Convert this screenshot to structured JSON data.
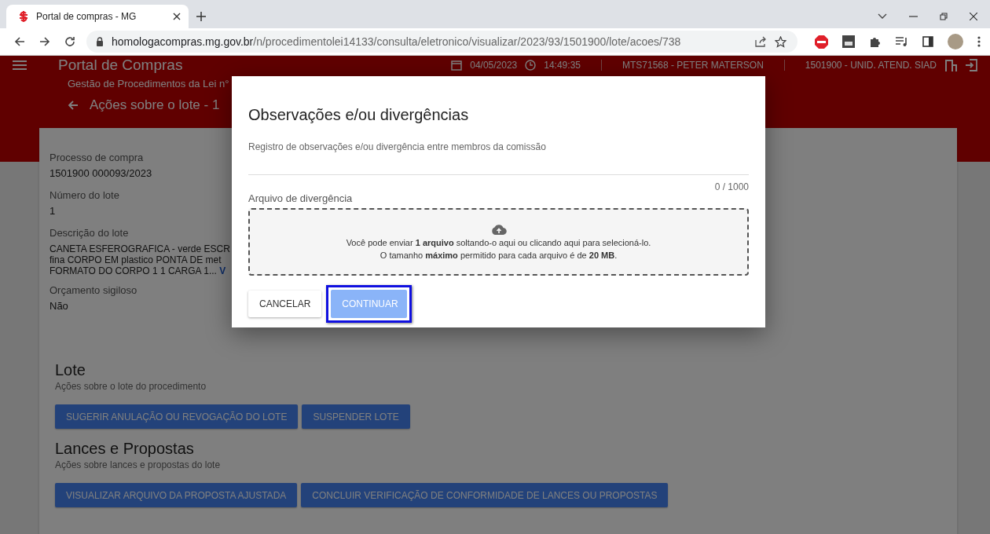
{
  "browser": {
    "tab_title": "Portal de compras - MG",
    "url_host": "homologacompras.mg.gov.br",
    "url_path": "/n/procedimentolei14133/consulta/eletronico/visualizar/2023/93/1501900/lote/acoes/738"
  },
  "header": {
    "title": "Portal de Compras",
    "date": "04/05/2023",
    "time": "14:49:35",
    "user": "MTS71568 - PETER MATERSON",
    "unit": "1501900 - UNID. ATEND. SIAD"
  },
  "breadcrumb": "Gestão de Procedimentos da Lei n°",
  "page_title": "Ações sobre o lote - 1",
  "fields": [
    {
      "label": "Processo de compra",
      "value": "1501900 000093/2023"
    },
    {
      "label": "Número do lote",
      "value": "1"
    },
    {
      "label": "Descrição do lote",
      "lines": [
        "CANETA ESFEROGRAFICA - verde ESCR",
        "fina CORPO EM plastico PONTA DE met",
        "FORMATO DO CORPO 1 1 CARGA 1..."
      ],
      "link": "V"
    },
    {
      "label": "Orçamento sigiloso",
      "value": "Não"
    }
  ],
  "sections": [
    {
      "title": "Lote",
      "subtitle": "Ações sobre o lote do procedimento",
      "buttons": [
        "SUGERIR ANULAÇÃO OU REVOGAÇÃO DO LOTE",
        "SUSPENDER LOTE"
      ]
    },
    {
      "title": "Lances e Propostas",
      "subtitle": "Ações sobre lances e propostas do lote",
      "buttons": [
        "VISUALIZAR ARQUIVO DA PROPOSTA AJUSTADA",
        "CONCLUIR VERIFICAÇÃO DE CONFORMIDADE DE LANCES OU PROPOSTAS"
      ]
    }
  ],
  "dialog": {
    "title": "Observações e/ou divergências",
    "textarea": {
      "placeholder": "Registro de observações e/ou divergência entre membros da comissão",
      "counter": "0 / 1000"
    },
    "file_label": "Arquivo de divergência",
    "drop_lines": [
      "Você pode enviar **1 arquivo** soltando-o aqui ou clicando aqui para selecioná-lo.",
      "O tamanho **máximo** permitido para cada arquivo é de **20 MB**."
    ],
    "buttons": [
      {
        "label": "CANCELAR",
        "kind": "secondary",
        "disabled": false,
        "highlighted": false
      },
      {
        "label": "CONTINUAR",
        "kind": "primary",
        "disabled": true,
        "highlighted": true
      }
    ]
  }
}
